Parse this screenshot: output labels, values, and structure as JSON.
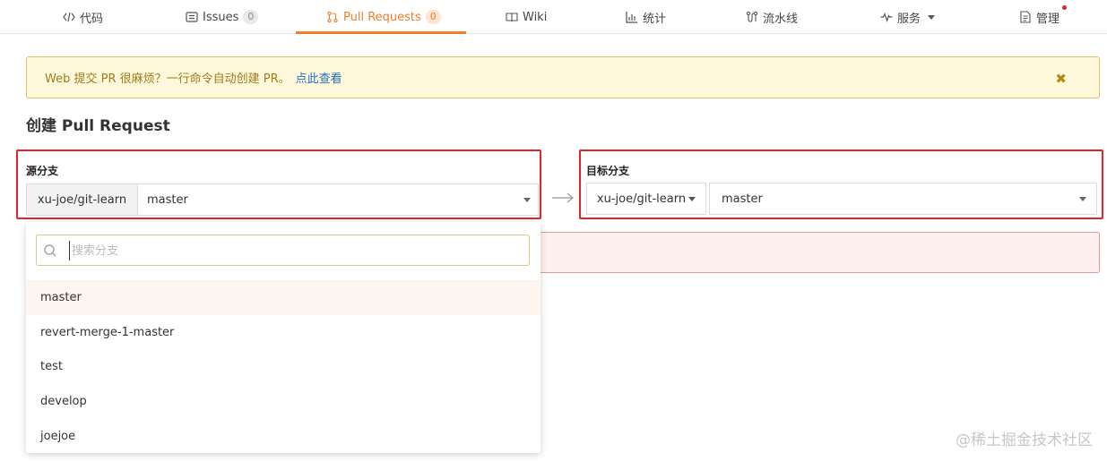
{
  "tabs": [
    {
      "label": "代码",
      "icon": "code-icon"
    },
    {
      "label": "Issues",
      "count": "0",
      "icon": "issues-icon"
    },
    {
      "label": "Pull Requests",
      "count": "0",
      "icon": "pull-request-icon"
    },
    {
      "label": "Wiki",
      "icon": "wiki-icon"
    },
    {
      "label": "统计",
      "icon": "stats-icon"
    },
    {
      "label": "流水线",
      "icon": "pipeline-icon"
    },
    {
      "label": "服务",
      "icon": "service-icon"
    },
    {
      "label": "管理",
      "icon": "manage-icon"
    }
  ],
  "active_tab": "Pull Requests",
  "colors": {
    "accent": "#f07e2a",
    "highlight_border": "#e0252a",
    "notice_bg": "#fff8db",
    "link": "#1e6fbe"
  },
  "notice": {
    "text": "Web 提交 PR 很麻烦？一行命令自动创建 PR。",
    "link": "点此查看",
    "close_icon": "close-icon"
  },
  "page_title": "创建 Pull Request",
  "source": {
    "label": "源分支",
    "repo": "xu-joe/git-learn",
    "branch": "master"
  },
  "target": {
    "label": "目标分支",
    "repo": "xu-joe/git-learn",
    "branch": "master"
  },
  "dropdown": {
    "search_placeholder": "搜索分支",
    "options": [
      "master",
      "revert-merge-1-master",
      "test",
      "develop",
      "joejoe"
    ],
    "selected": "master"
  },
  "watermark": "@稀土掘金技术社区"
}
